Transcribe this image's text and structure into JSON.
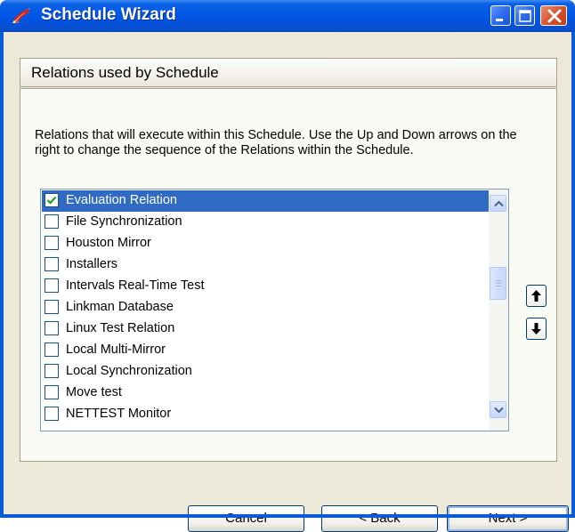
{
  "window": {
    "title": "Schedule Wizard",
    "icon": "app-logo-icon",
    "controls": [
      "minimize-icon",
      "maximize-icon",
      "close-icon"
    ]
  },
  "header": {
    "title": "Relations used by Schedule"
  },
  "description": "Relations that will execute within this Schedule. Use the Up and Down arrows on the right to change the sequence of the Relations within the Schedule.",
  "relations": [
    {
      "label": "Evaluation Relation",
      "checked": true,
      "selected": true
    },
    {
      "label": "File Synchronization",
      "checked": false,
      "selected": false
    },
    {
      "label": "Houston Mirror",
      "checked": false,
      "selected": false
    },
    {
      "label": "Installers",
      "checked": false,
      "selected": false
    },
    {
      "label": "Intervals Real-Time Test",
      "checked": false,
      "selected": false
    },
    {
      "label": "Linkman Database",
      "checked": false,
      "selected": false
    },
    {
      "label": "Linux Test Relation",
      "checked": false,
      "selected": false
    },
    {
      "label": "Local Multi-Mirror",
      "checked": false,
      "selected": false
    },
    {
      "label": "Local Synchronization",
      "checked": false,
      "selected": false
    },
    {
      "label": "Move test",
      "checked": false,
      "selected": false
    },
    {
      "label": "NETTEST Monitor",
      "checked": false,
      "selected": false
    }
  ],
  "order_buttons": {
    "up_icon": "move-up-arrow-icon",
    "down_icon": "move-down-arrow-icon"
  },
  "buttons": {
    "cancel": "Cancel",
    "back": "< Back",
    "next": "Next >"
  },
  "colors": {
    "titlebar": "#0055e5",
    "selection": "#316ac5",
    "dialog_bg": "#ece9d8",
    "checkmark": "#21a121"
  }
}
